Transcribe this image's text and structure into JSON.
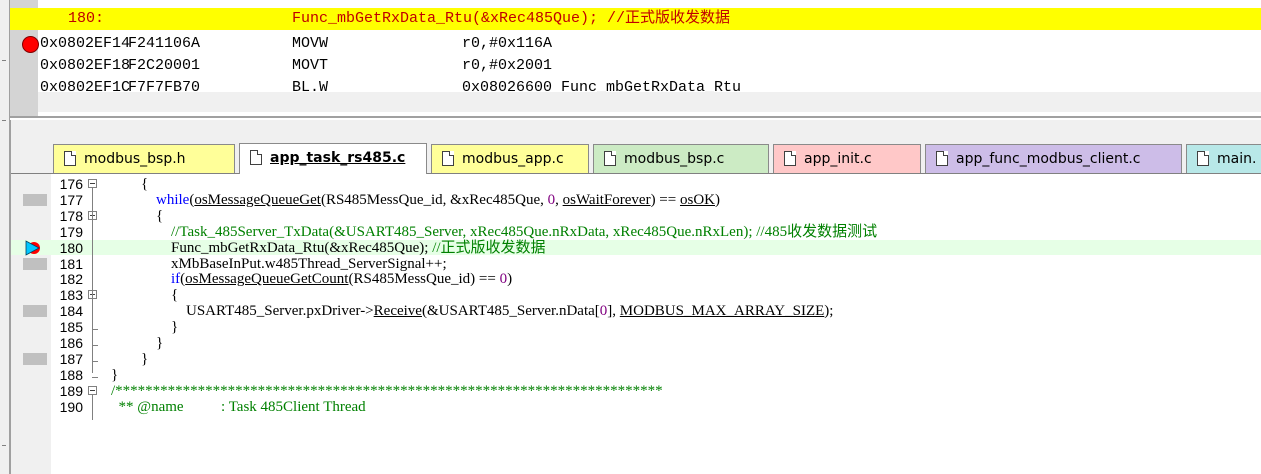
{
  "disassembly": {
    "source_line_no": "180:",
    "source_line_code": "Func_mbGetRxData_Rtu(&xRec485Que); //正式版收发数据",
    "instructions": [
      {
        "addr": "0x0802EF14",
        "hex": "F241106A",
        "mnemonic": "MOVW",
        "operands": "r0,#0x116A",
        "breakpoint": true
      },
      {
        "addr": "0x0802EF18",
        "hex": "F2C20001",
        "mnemonic": "MOVT",
        "operands": "r0,#0x2001",
        "breakpoint": false
      },
      {
        "addr": "0x0802EF1C",
        "hex": "F7F7FB70",
        "mnemonic": "BL.W",
        "operands": "0x08026600 Func_mbGetRxData_Rtu",
        "breakpoint": false
      }
    ]
  },
  "tabs": [
    {
      "label": "modbus_bsp.h",
      "color": "#ffff99",
      "active": false
    },
    {
      "label": "app_task_rs485.c",
      "color": "#ffffff",
      "active": true
    },
    {
      "label": "modbus_app.c",
      "color": "#ffff99",
      "active": false
    },
    {
      "label": "modbus_bsp.c",
      "color": "#ccebc4",
      "active": false
    },
    {
      "label": "app_init.c",
      "color": "#ffc8c8",
      "active": false
    },
    {
      "label": "app_func_modbus_client.c",
      "color": "#cdbde8",
      "active": false
    },
    {
      "label": "main.",
      "color": "#b8e8e8",
      "active": false
    }
  ],
  "code_lines": [
    {
      "num": "176",
      "indent": "        ",
      "parts": [
        {
          "t": "{",
          "c": ""
        }
      ]
    },
    {
      "num": "177",
      "indent": "            ",
      "parts": [
        {
          "t": "while",
          "c": "kw"
        },
        {
          "t": "(",
          "c": ""
        },
        {
          "t": "osMessageQueueGet",
          "c": "ul"
        },
        {
          "t": "(RS485MessQue_id, &xRec485Que, ",
          "c": ""
        },
        {
          "t": "0",
          "c": "num0"
        },
        {
          "t": ", ",
          "c": ""
        },
        {
          "t": "osWaitForever",
          "c": "ul"
        },
        {
          "t": ") == ",
          "c": ""
        },
        {
          "t": "osOK",
          "c": "ul"
        },
        {
          "t": ")",
          "c": ""
        }
      ]
    },
    {
      "num": "178",
      "indent": "            ",
      "parts": [
        {
          "t": "{",
          "c": ""
        }
      ]
    },
    {
      "num": "179",
      "indent": "                ",
      "parts": [
        {
          "t": "//Task_485Server_TxData(&USART485_Server, xRec485Que.nRxData, xRec485Que.nRxLen); //485收发数据测试",
          "c": "com"
        }
      ]
    },
    {
      "num": "180",
      "indent": "                ",
      "parts": [
        {
          "t": "Func_mbGetRxData_Rtu(&xRec485Que); ",
          "c": ""
        },
        {
          "t": "//正式版收发数据",
          "c": "com"
        }
      ]
    },
    {
      "num": "181",
      "indent": "                ",
      "parts": [
        {
          "t": "xMbBaseInPut.w485Thread_ServerSignal++;",
          "c": ""
        }
      ]
    },
    {
      "num": "182",
      "indent": "                ",
      "parts": [
        {
          "t": "if",
          "c": "kw"
        },
        {
          "t": "(",
          "c": ""
        },
        {
          "t": "osMessageQueueGetCount",
          "c": "ul"
        },
        {
          "t": "(RS485MessQue_id) == ",
          "c": ""
        },
        {
          "t": "0",
          "c": "num0"
        },
        {
          "t": ")",
          "c": ""
        }
      ]
    },
    {
      "num": "183",
      "indent": "                ",
      "parts": [
        {
          "t": "{",
          "c": ""
        }
      ]
    },
    {
      "num": "184",
      "indent": "                    ",
      "parts": [
        {
          "t": "USART485_Server.pxDriver->",
          "c": ""
        },
        {
          "t": "Receive",
          "c": "ul"
        },
        {
          "t": "(&USART485_Server.nData[",
          "c": ""
        },
        {
          "t": "0",
          "c": "num0"
        },
        {
          "t": "], ",
          "c": ""
        },
        {
          "t": "MODBUS_MAX_ARRAY_SIZE",
          "c": "ul"
        },
        {
          "t": ");",
          "c": ""
        }
      ]
    },
    {
      "num": "185",
      "indent": "                ",
      "parts": [
        {
          "t": "}",
          "c": ""
        }
      ]
    },
    {
      "num": "186",
      "indent": "            ",
      "parts": [
        {
          "t": "}",
          "c": ""
        }
      ]
    },
    {
      "num": "187",
      "indent": "        ",
      "parts": [
        {
          "t": "}",
          "c": ""
        }
      ]
    },
    {
      "num": "188",
      "indent": "",
      "parts": [
        {
          "t": "}",
          "c": ""
        }
      ]
    },
    {
      "num": "189",
      "indent": "",
      "parts": [
        {
          "t": "/*************************************************************************",
          "c": "com"
        }
      ]
    },
    {
      "num": "190",
      "indent": "  ",
      "parts": [
        {
          "t": "** @name",
          "c": "com"
        },
        {
          "t": "          : Task 485Client Thread",
          "c": "com"
        }
      ]
    }
  ],
  "colors": {
    "source_highlight": "#ffff00",
    "breakpoint": "#ff0000",
    "keyword": "#0000ff",
    "comment": "#008000",
    "current_line": "#e6ffe6"
  },
  "icons": {
    "breakpoint": "breakpoint-icon",
    "execution_arrow": "execution-arrow-icon",
    "tab_file": "file-icon",
    "fold_toggle": "fold-toggle-icon"
  }
}
